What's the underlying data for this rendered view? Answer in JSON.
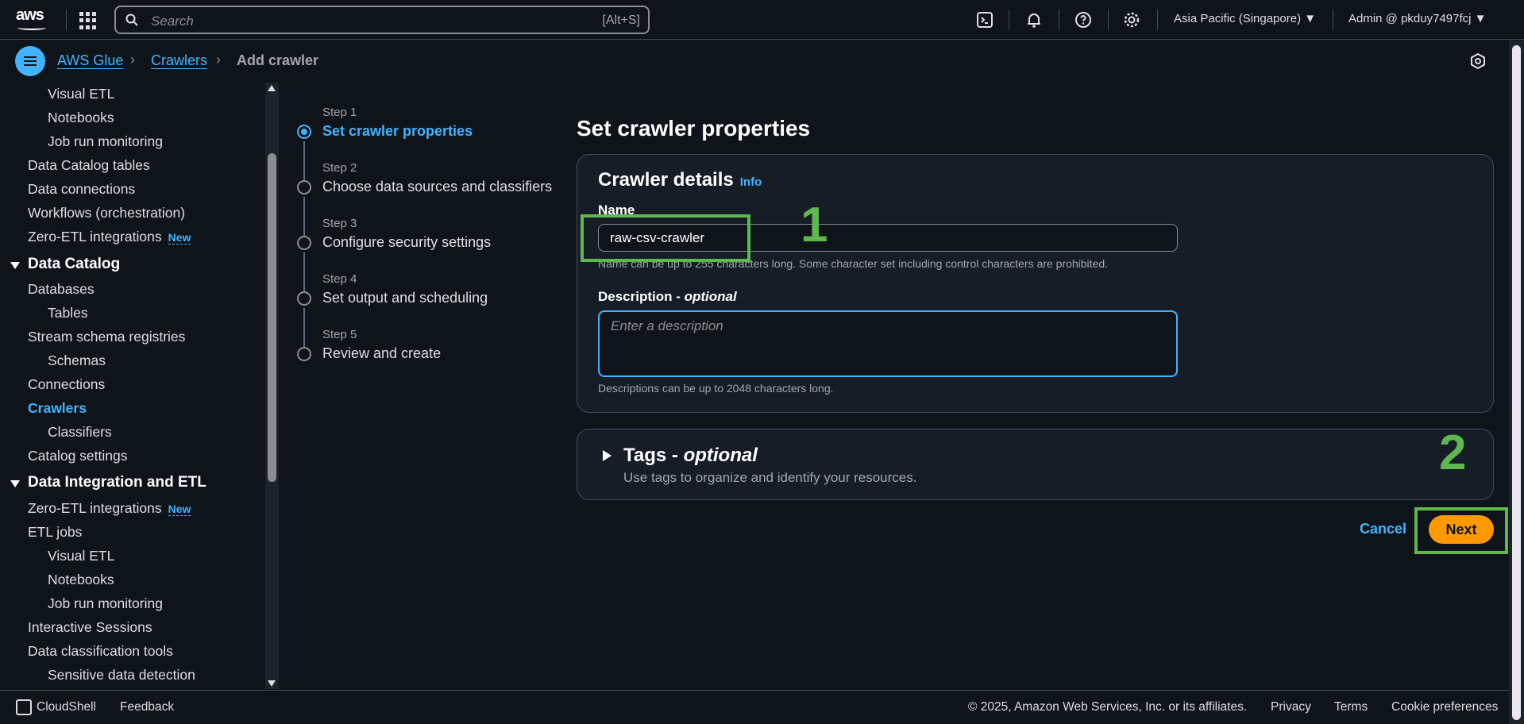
{
  "topnav": {
    "logo": "aws",
    "search_placeholder": "Search",
    "search_shortcut": "[Alt+S]",
    "icons": [
      "cloudshell-icon",
      "bell-icon",
      "help-icon",
      "gear-icon"
    ],
    "region": "Asia Pacific (Singapore)",
    "account": "Admin @ pkduy7497fcj"
  },
  "breadcrumb": {
    "items": [
      "AWS Glue",
      "Crawlers",
      "Add crawler"
    ]
  },
  "sidebar": {
    "items": [
      {
        "label": "Visual ETL"
      },
      {
        "label": "Notebooks"
      },
      {
        "label": "Job run monitoring"
      },
      {
        "label": "Data Catalog tables"
      },
      {
        "label": "Data connections"
      },
      {
        "label": "Workflows (orchestration)"
      },
      {
        "label": "Zero-ETL integrations",
        "badge": "New"
      },
      {
        "label": "Data Catalog"
      },
      {
        "label": "Databases"
      },
      {
        "label": "Tables"
      },
      {
        "label": "Stream schema registries"
      },
      {
        "label": "Schemas"
      },
      {
        "label": "Connections"
      },
      {
        "label": "Crawlers"
      },
      {
        "label": "Classifiers"
      },
      {
        "label": "Catalog settings"
      },
      {
        "label": "Data Integration and ETL"
      },
      {
        "label": "Zero-ETL integrations",
        "badge": "New"
      },
      {
        "label": "ETL jobs"
      },
      {
        "label": "Visual ETL"
      },
      {
        "label": "Notebooks"
      },
      {
        "label": "Job run monitoring"
      },
      {
        "label": "Interactive Sessions"
      },
      {
        "label": "Data classification tools"
      },
      {
        "label": "Sensitive data detection"
      }
    ]
  },
  "steps": [
    {
      "step": "Step 1",
      "title": "Set crawler properties"
    },
    {
      "step": "Step 2",
      "title": "Choose data sources and classifiers"
    },
    {
      "step": "Step 3",
      "title": "Configure security settings"
    },
    {
      "step": "Step 4",
      "title": "Set output and scheduling"
    },
    {
      "step": "Step 5",
      "title": "Review and create"
    }
  ],
  "main": {
    "title": "Set crawler properties",
    "details": {
      "title": "Crawler details",
      "info": "Info",
      "name_label": "Name",
      "name_value": "raw-csv-crawler",
      "name_hint": "Name can be up to 255 characters long. Some character set including control characters are prohibited.",
      "desc_label": "Description - ",
      "desc_optional": "optional",
      "desc_placeholder": "Enter a description",
      "desc_hint": "Descriptions can be up to 2048 characters long."
    },
    "tags": {
      "title": "Tags - ",
      "optional": "optional",
      "desc": "Use tags to organize and identify your resources."
    },
    "cancel": "Cancel",
    "next": "Next"
  },
  "annotations": [
    "1",
    "2"
  ],
  "footer": {
    "cloudshell": "CloudShell",
    "feedback": "Feedback",
    "copyright": "© 2025, Amazon Web Services, Inc. or its affiliates.",
    "privacy": "Privacy",
    "terms": "Terms",
    "cookies": "Cookie preferences"
  },
  "colors": {
    "accent": "#42b4ff",
    "primary_button": "#ff9900",
    "annotation": "#5fb84f",
    "background": "#0f141a"
  }
}
